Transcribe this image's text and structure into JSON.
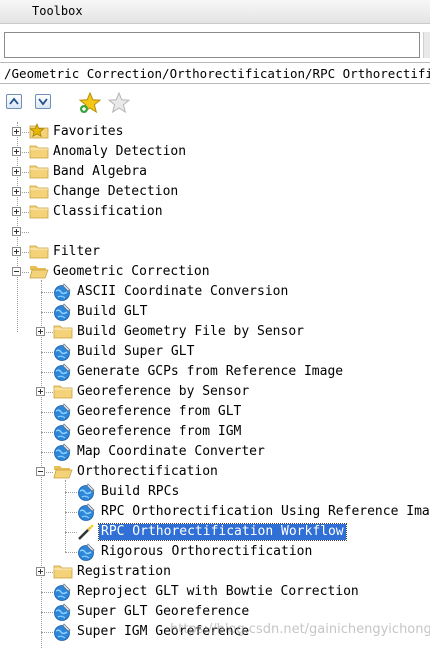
{
  "window": {
    "title": "Toolbox"
  },
  "search": {
    "value": "",
    "placeholder": ""
  },
  "path": {
    "text": "/Geometric Correction/Orthorectification/RPC Orthorectification Workflow"
  },
  "toolbar": {
    "expand_all": "expand-all",
    "collapse_all": "collapse-all",
    "add_favorite": "add-favorite",
    "remove_favorite": "remove-favorite"
  },
  "tree": {
    "items": [
      {
        "label": "Favorites",
        "level": 0,
        "kind": "favorites",
        "expander": "plus"
      },
      {
        "label": "Anomaly Detection",
        "level": 0,
        "kind": "folder",
        "expander": "plus"
      },
      {
        "label": "Band Algebra",
        "level": 0,
        "kind": "folder",
        "expander": "plus"
      },
      {
        "label": "Change Detection",
        "level": 0,
        "kind": "folder",
        "expander": "plus"
      },
      {
        "label": "Classification",
        "level": 0,
        "kind": "folder",
        "expander": "plus"
      },
      {
        "label": "",
        "level": 0,
        "kind": "none",
        "expander": "plus"
      },
      {
        "label": "Filter",
        "level": 0,
        "kind": "folder",
        "expander": "plus"
      },
      {
        "label": "Geometric Correction",
        "level": 0,
        "kind": "folder-open",
        "expander": "minus"
      },
      {
        "label": "ASCII Coordinate Conversion",
        "level": 1,
        "kind": "tool",
        "expander": ""
      },
      {
        "label": "Build GLT",
        "level": 1,
        "kind": "tool",
        "expander": ""
      },
      {
        "label": "Build Geometry File by Sensor",
        "level": 1,
        "kind": "folder",
        "expander": "plus"
      },
      {
        "label": "Build Super GLT",
        "level": 1,
        "kind": "tool",
        "expander": ""
      },
      {
        "label": "Generate GCPs from Reference Image",
        "level": 1,
        "kind": "tool",
        "expander": ""
      },
      {
        "label": "Georeference by Sensor",
        "level": 1,
        "kind": "folder",
        "expander": "plus"
      },
      {
        "label": "Georeference from GLT",
        "level": 1,
        "kind": "tool",
        "expander": ""
      },
      {
        "label": "Georeference from IGM",
        "level": 1,
        "kind": "tool",
        "expander": ""
      },
      {
        "label": "Map Coordinate Converter",
        "level": 1,
        "kind": "tool",
        "expander": ""
      },
      {
        "label": "Orthorectification",
        "level": 1,
        "kind": "folder-open",
        "expander": "minus"
      },
      {
        "label": "Build RPCs",
        "level": 2,
        "kind": "tool",
        "expander": ""
      },
      {
        "label": "RPC Orthorectification Using Reference Image",
        "level": 2,
        "kind": "tool",
        "expander": ""
      },
      {
        "label": "RPC Orthorectification Workflow",
        "level": 2,
        "kind": "wand",
        "expander": "",
        "selected": true
      },
      {
        "label": "Rigorous Orthorectification",
        "level": 2,
        "kind": "tool",
        "expander": ""
      },
      {
        "label": "Registration",
        "level": 1,
        "kind": "folder",
        "expander": "plus"
      },
      {
        "label": "Reproject GLT with Bowtie Correction",
        "level": 1,
        "kind": "tool",
        "expander": ""
      },
      {
        "label": "Super GLT Georeference",
        "level": 1,
        "kind": "tool",
        "expander": ""
      },
      {
        "label": "Super IGM Georeference",
        "level": 1,
        "kind": "tool",
        "expander": ""
      }
    ]
  },
  "watermark": {
    "text": "https://blog.csdn.net/gainichengyichongfu"
  },
  "colors": {
    "selection": "#2f6fd6",
    "folder": "#f3d27a",
    "tool_globe": "#2d86d9",
    "star": "#e6b800"
  }
}
